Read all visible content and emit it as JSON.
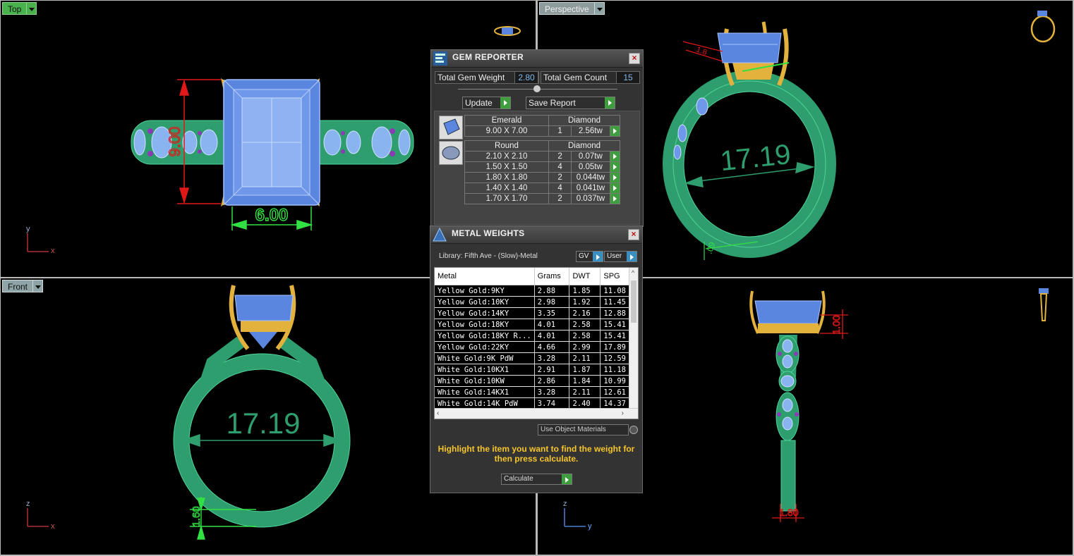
{
  "viewports": {
    "top": {
      "label": "Top",
      "axis_v": "y",
      "axis_h": "x",
      "dim_height": "9.00",
      "dim_width": "6.00"
    },
    "perspective": {
      "label": "Perspective",
      "dim_diameter": "17.19",
      "dim_small_a": "1.8",
      "dim_small_b": ".09"
    },
    "front": {
      "label": "Front",
      "axis_v": "z",
      "axis_h": "x",
      "dim_diameter": "17.19",
      "dim_band": "1.60"
    },
    "right": {
      "axis_v": "z",
      "axis_h": "y",
      "dim_band_top": "1.00",
      "dim_band_bottom": "1.80"
    }
  },
  "colors": {
    "band": "#2e9e6e",
    "gem": "#5b86e0",
    "prong": "#e3b23c",
    "dim_red": "#e01818",
    "dim_green": "#33e044",
    "panel_bg": "#333333",
    "go_green": "#3e9e3e"
  },
  "gem_reporter": {
    "title": "GEM REPORTER",
    "total_weight_label": "Total Gem Weight",
    "total_weight_value": "2.80",
    "total_count_label": "Total Gem Count",
    "total_count_value": "15",
    "update_label": "Update",
    "save_report_label": "Save Report",
    "groups": [
      {
        "shape": "Emerald",
        "material": "Diamond",
        "rows": [
          {
            "size": "9.00 X 7.00",
            "qty": "1",
            "weight": "2.56tw"
          }
        ]
      },
      {
        "shape": "Round",
        "material": "Diamond",
        "rows": [
          {
            "size": "2.10 X 2.10",
            "qty": "2",
            "weight": "0.07tw"
          },
          {
            "size": "1.50 X 1.50",
            "qty": "4",
            "weight": "0.05tw"
          },
          {
            "size": "1.80 X 1.80",
            "qty": "2",
            "weight": "0.044tw"
          },
          {
            "size": "1.40 X 1.40",
            "qty": "4",
            "weight": "0.041tw"
          },
          {
            "size": "1.70 X 1.70",
            "qty": "2",
            "weight": "0.037tw"
          }
        ]
      }
    ]
  },
  "metal_weights": {
    "title": "METAL WEIGHTS",
    "library": "Library: Fifth Ave - (Slow)-Metal",
    "gv_label": "GV",
    "user_label": "User",
    "columns": [
      "Metal",
      "Grams",
      "DWT",
      "SPG"
    ],
    "rows": [
      [
        "Yellow Gold:9KY",
        "2.88",
        "1.85",
        "11.08"
      ],
      [
        "Yellow Gold:10KY",
        "2.98",
        "1.92",
        "11.45"
      ],
      [
        "Yellow Gold:14KY",
        "3.35",
        "2.16",
        "12.88"
      ],
      [
        "Yellow Gold:18KY",
        "4.01",
        "2.58",
        "15.41"
      ],
      [
        "Yellow Gold:18KY R...",
        "4.01",
        "2.58",
        "15.41"
      ],
      [
        "Yellow Gold:22KY",
        "4.66",
        "2.99",
        "17.89"
      ],
      [
        "White Gold:9K PdW",
        "3.28",
        "2.11",
        "12.59"
      ],
      [
        "White Gold:10KX1",
        "2.91",
        "1.87",
        "11.18"
      ],
      [
        "White Gold:10KW",
        "2.86",
        "1.84",
        "10.99"
      ],
      [
        "White Gold:14KX1",
        "3.28",
        "2.11",
        "12.61"
      ],
      [
        "White Gold:14K PdW",
        "3.74",
        "2.40",
        "14.37"
      ]
    ],
    "use_object_materials_label": "Use Object Materials",
    "hint": "Highlight the item you want to find the weight for then press calculate.",
    "calculate_label": "Calculate"
  }
}
